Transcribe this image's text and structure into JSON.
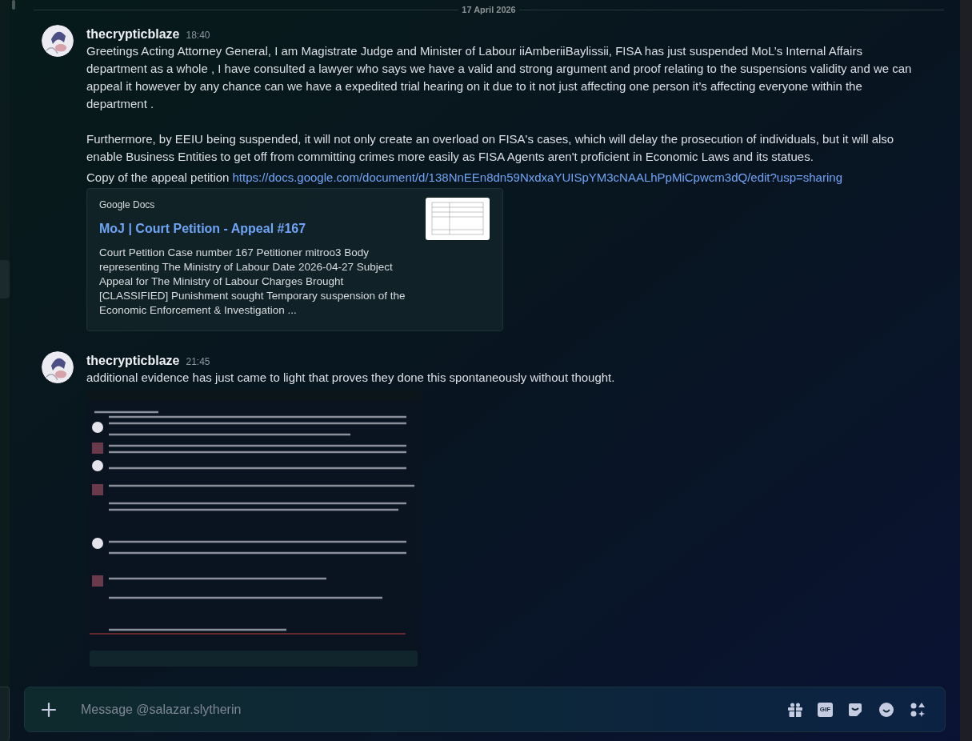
{
  "date_divider": "17 April 2026",
  "messages": [
    {
      "author": "thecrypticblaze",
      "time": "18:40",
      "paragraphs": [
        "Greetings Acting Attorney General, I am Magistrate Judge and Minister of Labour iiAmberiiBaylissii, FISA has just suspended MoL’s Internal Affairs department as a whole , I have consulted a lawyer who says we have a valid and strong argument and proof relating to the suspensions validity and we can appeal it however by any chance can we have a expedited trial hearing on it due to it not just affecting one person it’s affecting everyone within the department .",
        "Furthermore, by EEIU being suspended, it will not only create an overload on FISA's cases, which will delay the prosecution of individuals, but it will also enable Business Entities to get off from committing crimes more easily as FISA Agents aren't proficient in Economic Laws and its statues."
      ],
      "link_line": {
        "text": "Copy of the appeal petition",
        "url": "https://docs.google.com/document/d/138NnEEn8dn59NxdxaYUISpYM3cNAALhPpMiCpwcm3dQ/edit?usp=sharing"
      },
      "embed": {
        "provider": "Google Docs",
        "title": "MoJ | Court Petition - Appeal #167",
        "description": "Court Petition Case number 167 Petitioner mitroo3 Body representing The Ministry of Labour Date 2026-04-27 Subject Appeal for The Ministry of Labour Charges Brought [CLASSIFIED] Punishment sought Temporary suspension of the Economic Enforcement & Investigation ..."
      }
    },
    {
      "author": "thecrypticblaze",
      "time": "21:45",
      "paragraphs": [
        "additional evidence has just came to light that proves they done this spontaneously without thought."
      ],
      "attachment": {
        "kind": "picture"
      }
    }
  ],
  "composer": {
    "placeholder": "Message @salazar.slytherin",
    "gif_label": "GIF"
  }
}
